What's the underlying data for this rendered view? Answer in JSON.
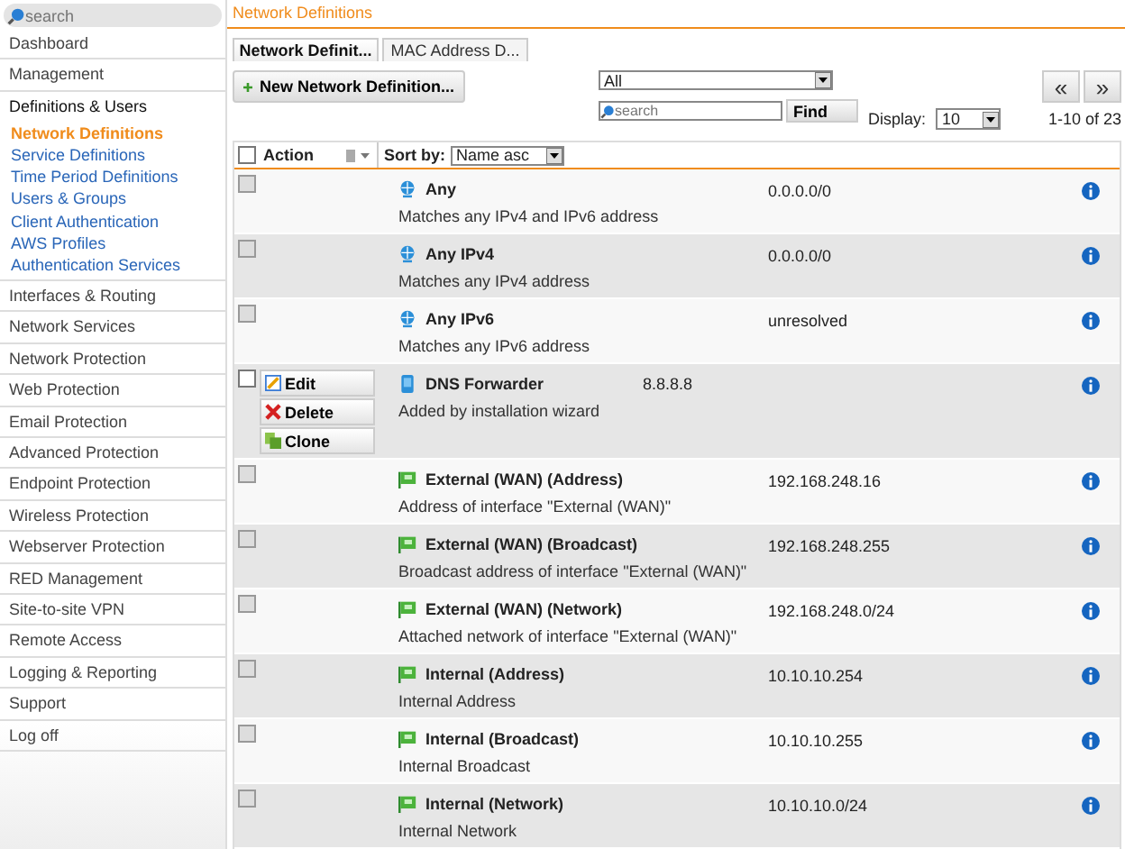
{
  "top_search": {
    "placeholder": "search"
  },
  "page_title": "Network Definitions",
  "sidebar": {
    "items": [
      {
        "label": "Dashboard",
        "selected": false
      },
      {
        "label": "Management",
        "selected": false
      },
      {
        "label": "Definitions & Users",
        "selected": false,
        "expanded": true,
        "children": [
          {
            "label": "Network Definitions",
            "selected": true
          },
          {
            "label": "Service Definitions",
            "selected": false
          },
          {
            "label": "Time Period Definitions",
            "selected": false
          },
          {
            "label": "Users & Groups",
            "selected": false
          },
          {
            "label": "Client Authentication",
            "selected": false
          },
          {
            "label": "AWS Profiles",
            "selected": false
          },
          {
            "label": "Authentication Services",
            "selected": false
          }
        ]
      },
      {
        "label": "Interfaces & Routing",
        "selected": false
      },
      {
        "label": "Network Services",
        "selected": false
      },
      {
        "label": "Network Protection",
        "selected": false
      },
      {
        "label": "Web Protection",
        "selected": false
      },
      {
        "label": "Email Protection",
        "selected": false
      },
      {
        "label": "Advanced Protection",
        "selected": false
      },
      {
        "label": "Endpoint Protection",
        "selected": false
      },
      {
        "label": "Wireless Protection",
        "selected": false
      },
      {
        "label": "Webserver Protection",
        "selected": false
      },
      {
        "label": "RED Management",
        "selected": false
      },
      {
        "label": "Site-to-site VPN",
        "selected": false
      },
      {
        "label": "Remote Access",
        "selected": false
      },
      {
        "label": "Logging & Reporting",
        "selected": false
      },
      {
        "label": "Support",
        "selected": false
      },
      {
        "label": "Log off",
        "selected": false
      }
    ]
  },
  "tabs": [
    {
      "label": "Network Definit...",
      "selected": true
    },
    {
      "label": "MAC Address D...",
      "selected": false
    }
  ],
  "toolbar": {
    "new_button": "New Network Definition...",
    "filter": {
      "value": "All"
    },
    "search": {
      "placeholder": "search"
    },
    "find_button": "Find",
    "display_label": "Display:",
    "display": {
      "value": "10"
    },
    "prev_button": "«",
    "next_button": "»",
    "range": "1-10 of 23"
  },
  "table": {
    "select_all": {
      "checked": false
    },
    "columns": [
      {
        "label": "Action"
      },
      {
        "label": "Sort by:"
      }
    ],
    "sort": {
      "value": "Name asc"
    },
    "rows": [
      {
        "kind": "any",
        "name": "Any",
        "comment": "Matches any IPv4 and IPv6 address",
        "address": "0.0.0.0/0",
        "expanded": false,
        "disabled": true
      },
      {
        "kind": "any",
        "name": "Any IPv4",
        "comment": "Matches any IPv4 address",
        "address": "0.0.0.0/0",
        "expanded": false,
        "disabled": true
      },
      {
        "kind": "any",
        "name": "Any IPv6",
        "comment": "Matches any IPv6 address",
        "address": "unresolved",
        "expanded": false,
        "disabled": true
      },
      {
        "kind": "host",
        "name": "DNS Forwarder",
        "comment": "Added by installation wizard",
        "host_address": "8.8.8.8",
        "expanded": true,
        "disabled": false,
        "actions": [
          "Edit",
          "Delete",
          "Clone"
        ]
      },
      {
        "kind": "interface",
        "name": "External (WAN) (Address)",
        "comment": "Address of interface \"External (WAN)\"",
        "address": "192.168.248.16",
        "expanded": false,
        "disabled": true
      },
      {
        "kind": "interface",
        "name": "External (WAN) (Broadcast)",
        "comment": "Broadcast address of interface \"External (WAN)\"",
        "address": "192.168.248.255",
        "expanded": false,
        "disabled": true
      },
      {
        "kind": "interface",
        "name": "External (WAN) (Network)",
        "comment": "Attached network of interface \"External (WAN)\"",
        "address": "192.168.248.0/24",
        "expanded": false,
        "disabled": true
      },
      {
        "kind": "interface",
        "name": "Internal (Address)",
        "comment": "Internal Address",
        "address": "10.10.10.254",
        "expanded": false,
        "disabled": true
      },
      {
        "kind": "interface",
        "name": "Internal (Broadcast)",
        "comment": "Internal Broadcast",
        "address": "10.10.10.255",
        "expanded": false,
        "disabled": true
      },
      {
        "kind": "interface",
        "name": "Internal (Network)",
        "comment": "Internal Network",
        "address": "10.10.10.0/24",
        "expanded": false,
        "disabled": true
      }
    ]
  }
}
